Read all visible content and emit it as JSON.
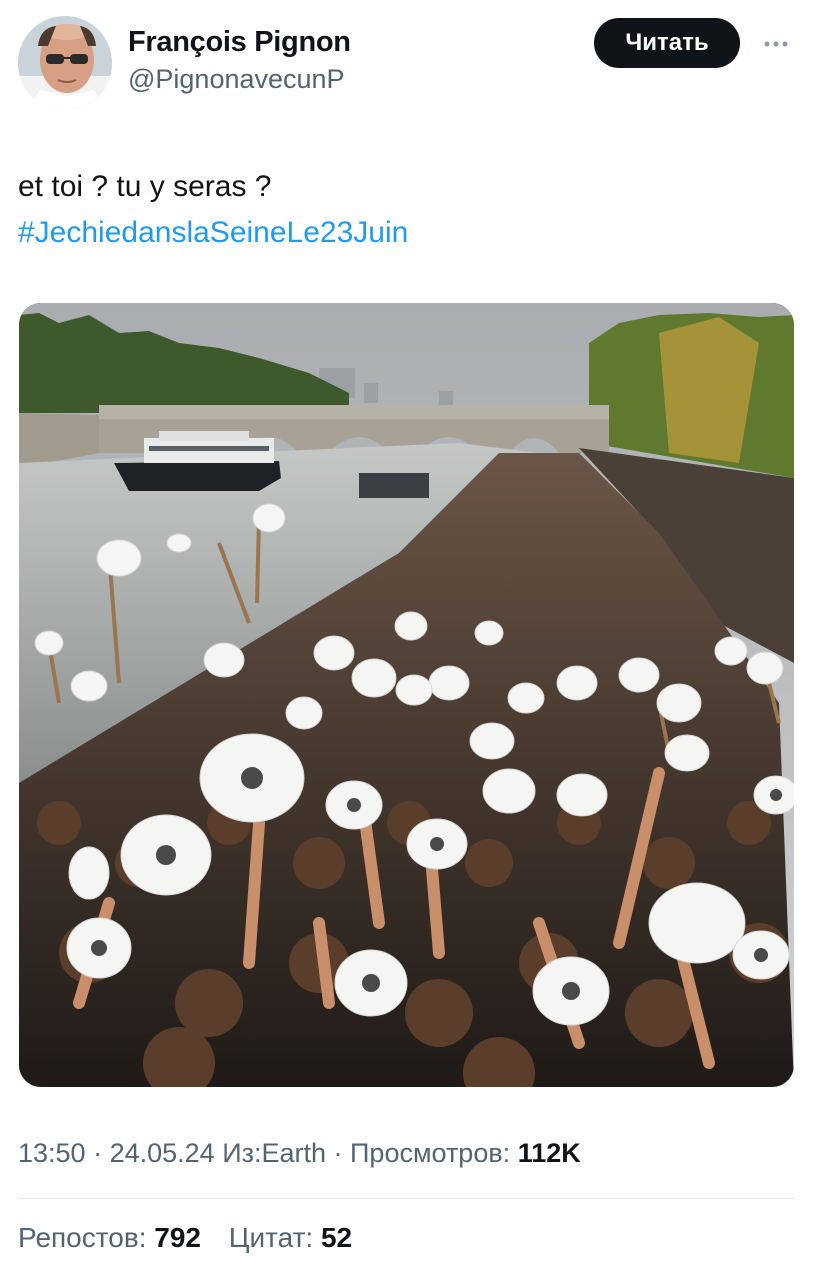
{
  "author": {
    "display_name": "François Pignon",
    "handle": "@PignonavecunP",
    "avatar_icon": "user-avatar"
  },
  "follow_button": {
    "label": "Читать"
  },
  "more_button": {
    "icon": "more-horizontal-icon"
  },
  "tweet": {
    "line1": "et toi ? tu y seras ?",
    "hashtag": "#JechiedanslaSeineLe23Juin"
  },
  "media": {
    "description_icon": "photo-crowd-toilet-paper-seine"
  },
  "meta": {
    "time": "13:50",
    "sep1": " · ",
    "date": "24.05.24",
    "source": " Из:Earth",
    "sep2": " · ",
    "views_label": "Просмотров: ",
    "views_value": "112K"
  },
  "stats": {
    "reposts_label": "Репостов: ",
    "reposts_value": "792",
    "quotes_label": "Цитат: ",
    "quotes_value": "52"
  },
  "colors": {
    "link": "#1d9bf0",
    "secondary_text": "#536471",
    "primary_text": "#0f1419",
    "button_bg": "#0f1419"
  }
}
